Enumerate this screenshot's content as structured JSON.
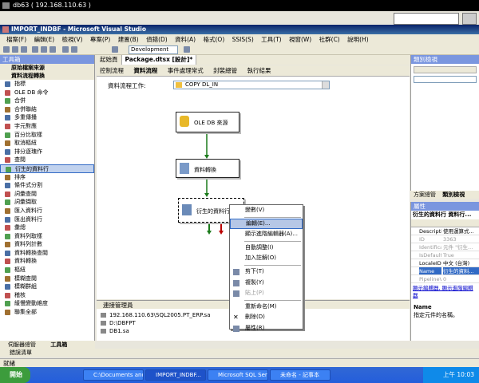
{
  "remote": {
    "title": "db63 ( 192.168.110.63 )",
    "ip": "192.168.110.63"
  },
  "vs": {
    "title": "IMPORT_INDBF - Microsoft Visual Studio"
  },
  "menu": [
    "檔案(F)",
    "編輯(E)",
    "檢視(V)",
    "專案(P)",
    "建置(B)",
    "偵錯(D)",
    "資料(A)",
    "格式(O)",
    "SSIS(S)",
    "工具(T)",
    "視窗(W)",
    "社群(C)",
    "說明(H)"
  ],
  "toolbar": {
    "config": "Development"
  },
  "toolbox": {
    "title": "工具箱",
    "section1": "原始檔案來源",
    "section2": "資料流程轉換",
    "items": [
      "指標",
      "OLE DB 命令",
      "合併",
      "合併聯結",
      "多重傳播",
      "字元對應",
      "百分比取樣",
      "取消樞紐",
      "排分逐瑰作",
      "查閱",
      "衍生的資料行",
      "排序",
      "條件式分割",
      "詞彙查閱",
      "詞彙擷取",
      "匯入資料行",
      "匯出資料行",
      "彙總",
      "資料列取樣",
      "資料列計數",
      "資料轉換查閱",
      "資料轉換",
      "樞紐",
      "模糊查閱",
      "模糊群組",
      "稽核",
      "緩慢變動維度",
      "聯集全部"
    ],
    "tabs": [
      "伺服器總管",
      "工具箱"
    ]
  },
  "doc": {
    "tabs": [
      "起始頁",
      "Package.dtsx [設計]*"
    ],
    "subtabs": [
      "控制流程",
      "資料流程",
      "事件處理常式",
      "封裝總管",
      "執行結果"
    ],
    "dataflow_label": "資料流程工作:",
    "dataflow_task": "COPY DL_IN",
    "comp1": "OLE DB 來源",
    "comp2": "資料轉換",
    "comp3": "衍生的資料行"
  },
  "context_menu": {
    "items": [
      "變數(V)",
      "編輯(E)...",
      "顯示進階編輯器(A)...",
      "自動調整(I)",
      "加入註解(O)",
      "剪下(T)",
      "複製(Y)",
      "貼上(P)",
      "重新命名(M)",
      "刪除(D)",
      "屬性(R)"
    ],
    "highlighted": "編輯(E)..."
  },
  "conn": {
    "title": "連接管理員",
    "items": [
      "192.168.110.63\\SQL2005.PT_ERP.sa",
      "D:\\DBFPT",
      "DB1.sa"
    ]
  },
  "right": {
    "solex_title": "類別檢視",
    "tabs": [
      "方案總管",
      "類別檢視"
    ],
    "props_title": "屬性",
    "props_object": "衍生的資料行 資料行...",
    "props": [
      {
        "k": "Descriptio",
        "v": "使用運算式..."
      },
      {
        "k": "ID",
        "v": "3363"
      },
      {
        "k": "Identifica",
        "v": "元件 \"衍生..."
      },
      {
        "k": "IsDefaultL",
        "v": "True"
      },
      {
        "k": "LocaleID",
        "v": "中文 (台灣)"
      },
      {
        "k": "Name",
        "v": "衍生的資料..."
      },
      {
        "k": "PipelineV",
        "v": "0"
      }
    ],
    "links": "顯示編輯器, 顯示進階編輯器",
    "desc_title": "Name",
    "desc": "指定元件的名稱。"
  },
  "bottom": {
    "errors": "錯誤清單",
    "status": "就緒"
  },
  "taskbar": {
    "start": "開始",
    "tasks": [
      "C:\\Documents and S...",
      "IMPORT_INDBF...",
      "Microsoft SQL Serve...",
      "未命名 - 記事本"
    ],
    "clock": "上午 10:03"
  }
}
